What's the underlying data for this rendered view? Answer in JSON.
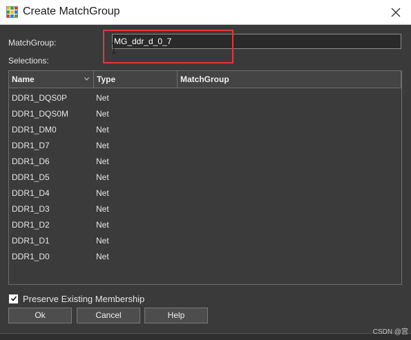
{
  "window": {
    "title": "Create MatchGroup",
    "app_icon": "grid-app-icon",
    "close_icon": "close-icon"
  },
  "form": {
    "matchgroup_label": "MatchGroup:",
    "matchgroup_value": "MG_ddr_d_0_7",
    "selections_label": "Selections:"
  },
  "table": {
    "columns": [
      "Name",
      "Type",
      "MatchGroup"
    ],
    "rows": [
      {
        "name": "DDR1_DQS0P",
        "type": "Net",
        "matchgroup": ""
      },
      {
        "name": "DDR1_DQS0M",
        "type": "Net",
        "matchgroup": ""
      },
      {
        "name": "DDR1_DM0",
        "type": "Net",
        "matchgroup": ""
      },
      {
        "name": "DDR1_D7",
        "type": "Net",
        "matchgroup": ""
      },
      {
        "name": "DDR1_D6",
        "type": "Net",
        "matchgroup": ""
      },
      {
        "name": "DDR1_D5",
        "type": "Net",
        "matchgroup": ""
      },
      {
        "name": "DDR1_D4",
        "type": "Net",
        "matchgroup": ""
      },
      {
        "name": "DDR1_D3",
        "type": "Net",
        "matchgroup": ""
      },
      {
        "name": "DDR1_D2",
        "type": "Net",
        "matchgroup": ""
      },
      {
        "name": "DDR1_D1",
        "type": "Net",
        "matchgroup": ""
      },
      {
        "name": "DDR1_D0",
        "type": "Net",
        "matchgroup": ""
      }
    ]
  },
  "options": {
    "preserve_label": "Preserve Existing Membership",
    "preserve_checked": true
  },
  "buttons": {
    "ok": "Ok",
    "cancel": "Cancel",
    "help": "Help"
  },
  "watermark": "CSDN @宫",
  "colors": {
    "background": "#3a3a3a",
    "highlight": "#e53935",
    "titlebar": "#ffffff"
  }
}
